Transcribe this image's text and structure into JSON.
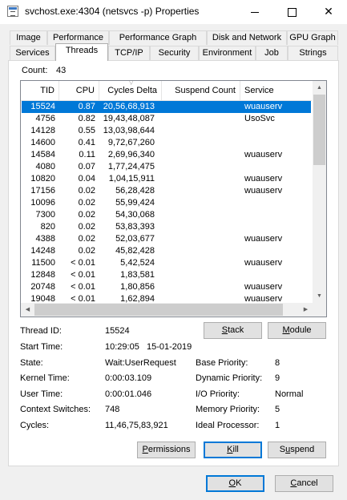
{
  "window": {
    "title": "svchost.exe:4304 (netsvcs -p) Properties"
  },
  "tabs_row1": [
    "Image",
    "Performance",
    "Performance Graph",
    "Disk and Network",
    "GPU Graph"
  ],
  "tabs_row2": [
    "Services",
    "Threads",
    "TCP/IP",
    "Security",
    "Environment",
    "Job",
    "Strings"
  ],
  "active_tab": "Threads",
  "count": {
    "label": "Count:",
    "value": "43"
  },
  "columns": [
    "TID",
    "CPU",
    "Cycles Delta",
    "Suspend Count",
    "Service"
  ],
  "threads": [
    {
      "tid": "15524",
      "cpu": "0.87",
      "cycles": "20,56,68,913",
      "service": "wuauserv",
      "selected": true
    },
    {
      "tid": "4756",
      "cpu": "0.82",
      "cycles": "19,43,48,087",
      "service": "UsoSvc"
    },
    {
      "tid": "14128",
      "cpu": "0.55",
      "cycles": "13,03,98,644",
      "service": ""
    },
    {
      "tid": "14600",
      "cpu": "0.41",
      "cycles": "9,72,67,260",
      "service": ""
    },
    {
      "tid": "14584",
      "cpu": "0.11",
      "cycles": "2,69,96,340",
      "service": "wuauserv"
    },
    {
      "tid": "4080",
      "cpu": "0.07",
      "cycles": "1,77,24,475",
      "service": ""
    },
    {
      "tid": "10820",
      "cpu": "0.04",
      "cycles": "1,04,15,911",
      "service": "wuauserv"
    },
    {
      "tid": "17156",
      "cpu": "0.02",
      "cycles": "56,28,428",
      "service": "wuauserv"
    },
    {
      "tid": "10096",
      "cpu": "0.02",
      "cycles": "55,99,424",
      "service": ""
    },
    {
      "tid": "7300",
      "cpu": "0.02",
      "cycles": "54,30,068",
      "service": ""
    },
    {
      "tid": "820",
      "cpu": "0.02",
      "cycles": "53,83,393",
      "service": ""
    },
    {
      "tid": "4388",
      "cpu": "0.02",
      "cycles": "52,03,677",
      "service": "wuauserv"
    },
    {
      "tid": "14248",
      "cpu": "0.02",
      "cycles": "45,82,428",
      "service": ""
    },
    {
      "tid": "11500",
      "cpu": "< 0.01",
      "cycles": "5,42,524",
      "service": "wuauserv"
    },
    {
      "tid": "12848",
      "cpu": "< 0.01",
      "cycles": "1,83,581",
      "service": ""
    },
    {
      "tid": "20748",
      "cpu": "< 0.01",
      "cycles": "1,80,856",
      "service": "wuauserv"
    },
    {
      "tid": "19048",
      "cpu": "< 0.01",
      "cycles": "1,62,894",
      "service": "wuauserv"
    }
  ],
  "buttons": {
    "stack": "Stack",
    "module": "Module",
    "permissions": "Permissions",
    "kill": "Kill",
    "suspend": "Suspend",
    "ok": "OK",
    "cancel": "Cancel"
  },
  "details": {
    "thread_id_label": "Thread ID:",
    "thread_id": "15524",
    "start_time_label": "Start Time:",
    "start_time": "10:29:05   15-01-2019",
    "state_label": "State:",
    "state": "Wait:UserRequest",
    "base_priority_label": "Base Priority:",
    "base_priority": "8",
    "kernel_time_label": "Kernel Time:",
    "kernel_time": "0:00:03.109",
    "dynamic_priority_label": "Dynamic Priority:",
    "dynamic_priority": "9",
    "user_time_label": "User Time:",
    "user_time": "0:00:01.046",
    "io_priority_label": "I/O Priority:",
    "io_priority": "Normal",
    "context_switches_label": "Context Switches:",
    "context_switches": "748",
    "memory_priority_label": "Memory Priority:",
    "memory_priority": "5",
    "cycles_label": "Cycles:",
    "cycles": "11,46,75,83,921",
    "ideal_processor_label": "Ideal Processor:",
    "ideal_processor": "1"
  },
  "colors": {
    "selection": "#0078d7",
    "default_button_border": "#0078d7"
  }
}
